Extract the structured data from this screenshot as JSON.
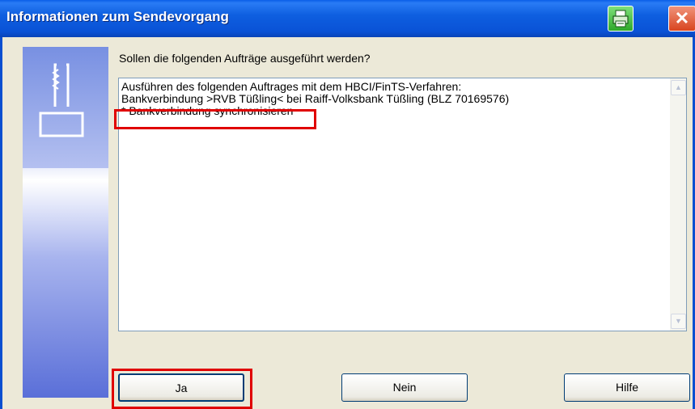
{
  "window": {
    "title": "Informationen zum Sendevorgang",
    "title_icons": [
      "printer-icon",
      "close-icon"
    ],
    "close_glyph": "✕"
  },
  "dialog": {
    "question": "Sollen die folgenden Aufträge ausgeführt werden?",
    "details": [
      "Ausführen des folgenden Auftrages mit dem HBCI/FinTS-Verfahren:",
      "Bankverbindung >RVB Tüßling< bei Raiff-Volksbank Tüßling (BLZ 70169576)",
      "* Bankverbindung synchronisieren"
    ]
  },
  "buttons": {
    "ja": "Ja",
    "nein": "Nein",
    "hilfe": "Hilfe"
  },
  "colors": {
    "titlebar": "#0a52d6",
    "highlight": "#e00000",
    "dialog_bg": "#ece9d8"
  }
}
